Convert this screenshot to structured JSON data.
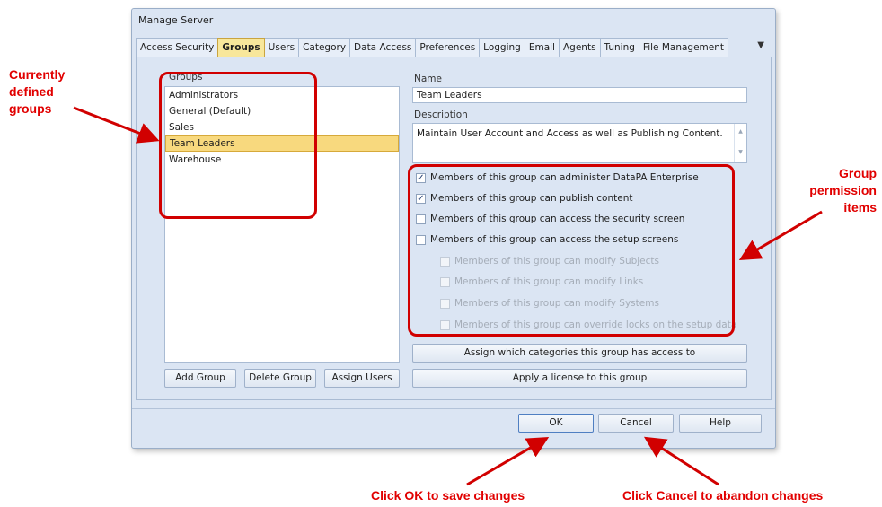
{
  "dialog": {
    "title": "Manage Server",
    "tabs": [
      "Access Security",
      "Groups",
      "Users",
      "Category",
      "Data Access",
      "Preferences",
      "Logging",
      "Email",
      "Agents",
      "Tuning",
      "File Management"
    ],
    "active_tab": "Groups",
    "groups_label": "Groups",
    "groups": [
      "Administrators",
      "General (Default)",
      "Sales",
      "Team Leaders",
      "Warehouse"
    ],
    "selected_group": "Team Leaders",
    "name_label": "Name",
    "name_value": "Team Leaders",
    "description_label": "Description",
    "description_value": "Maintain User Account and Access as well as Publishing Content.",
    "permissions": [
      {
        "label": "Members of this group can administer DataPA Enterprise",
        "checked": true,
        "enabled": true,
        "indent": false
      },
      {
        "label": "Members of this group can publish content",
        "checked": true,
        "enabled": true,
        "indent": false
      },
      {
        "label": "Members of this group can access the security screen",
        "checked": false,
        "enabled": true,
        "indent": false
      },
      {
        "label": "Members of this group can access the setup screens",
        "checked": false,
        "enabled": true,
        "indent": false
      },
      {
        "label": "Members of this group can modify Subjects",
        "checked": false,
        "enabled": false,
        "indent": true
      },
      {
        "label": "Members of this group can modify Links",
        "checked": false,
        "enabled": false,
        "indent": true
      },
      {
        "label": "Members of this group can modify Systems",
        "checked": false,
        "enabled": false,
        "indent": true
      },
      {
        "label": "Members of this group can override locks on the setup data",
        "checked": false,
        "enabled": false,
        "indent": true
      }
    ],
    "buttons": {
      "assign_categories": "Assign which categories this group has access to",
      "apply_license": "Apply a license to this group",
      "add_group": "Add Group",
      "delete_group": "Delete Group",
      "assign_users": "Assign Users",
      "ok": "OK",
      "cancel": "Cancel",
      "help": "Help"
    }
  },
  "annotations": {
    "groups_callout": "Currently defined groups",
    "permissions_callout": "Group permission items",
    "ok_callout": "Click OK to save changes",
    "cancel_callout": "Click Cancel to abandon changes",
    "color": "#e10000"
  }
}
